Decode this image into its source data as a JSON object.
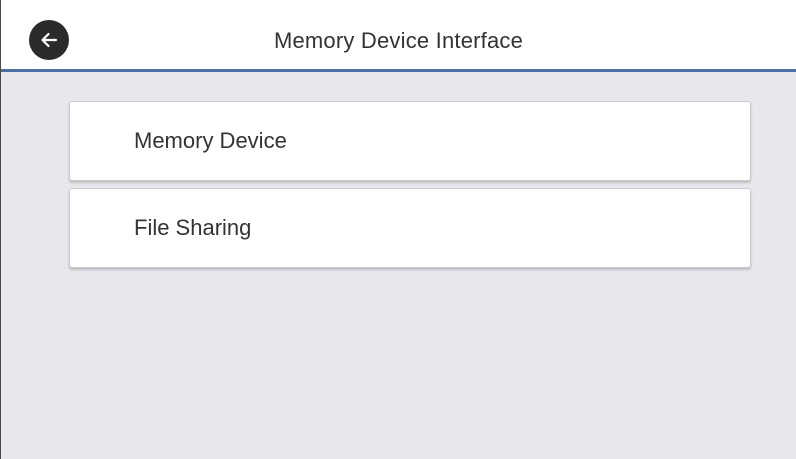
{
  "header": {
    "title": "Memory Device Interface",
    "back_icon": "arrow-left-icon"
  },
  "menu": {
    "items": [
      {
        "label": "Memory Device"
      },
      {
        "label": "File Sharing"
      }
    ]
  },
  "colors": {
    "header_border": "#4d6ea3",
    "background": "#e7e8ec",
    "back_button": "#2b2b2b"
  }
}
